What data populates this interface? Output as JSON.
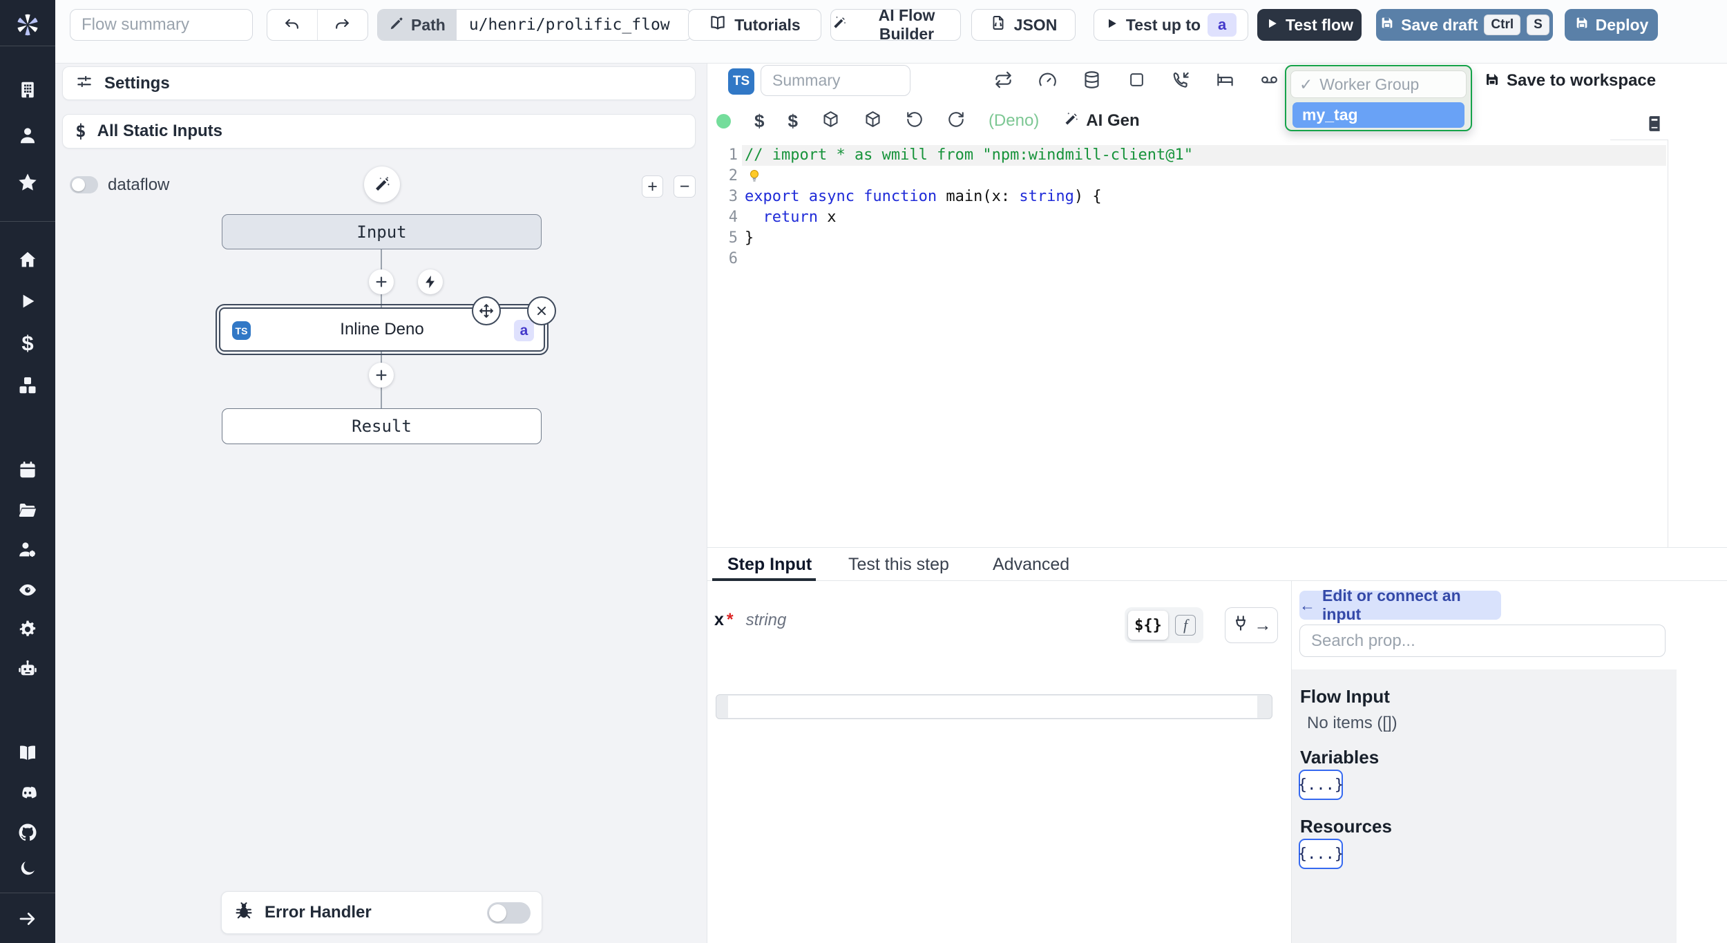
{
  "colors": {
    "sidebar_bg": "#1e2532",
    "primary_button": "#5a80a8",
    "dark_button": "#2b3442",
    "ts_badge": "#3178c6",
    "id_badge_bg": "#dfe1fd",
    "id_badge_text": "#4338ca",
    "worker_group_border": "#16a34a",
    "worker_group_selected_bg": "#69a2f6",
    "connect_pill_bg": "#d9e2fc",
    "connect_pill_text": "#3449a8",
    "code_comment": "#17933b",
    "code_keyword": "#1f2bd8"
  },
  "topbar": {
    "flow_summary_placeholder": "Flow summary",
    "path_label": "Path",
    "path_value": "u/henri/prolific_flow",
    "tutorials_label": "Tutorials",
    "ai_flow_builder_label": "AI Flow Builder",
    "json_label": "JSON",
    "test_up_to_label": "Test up to",
    "test_up_to_badge": "a",
    "test_flow_label": "Test flow",
    "save_draft_label": "Save draft",
    "shortcut_ctrl": "Ctrl",
    "shortcut_s": "S",
    "deploy_label": "Deploy"
  },
  "flow_panel": {
    "settings_label": "Settings",
    "all_static_inputs_label": "All Static Inputs",
    "static_inputs_icon": "$",
    "dataflow_label": "dataflow",
    "zoom_in": "+",
    "zoom_out": "−",
    "input_node": "Input",
    "step_node": {
      "lang_badge": "TS",
      "label": "Inline Deno",
      "id_badge": "a"
    },
    "result_node": "Result",
    "error_handler_label": "Error Handler"
  },
  "editor": {
    "lang_badge": "TS",
    "summary_placeholder": "Summary",
    "dollar_icon": "$",
    "worker_group_dropdown": {
      "check": "✓",
      "label": "Worker Group",
      "options": [
        "my_tag"
      ],
      "selected_option": "my_tag"
    },
    "save_to_workspace_label": "Save to workspace",
    "deno_label": "(Deno)",
    "ai_gen_label": "AI Gen",
    "line_numbers": [
      "1",
      "2",
      "3",
      "4",
      "5",
      "6"
    ],
    "code": {
      "line1_comment": "// import * as wmill from \"npm:windmill-client@1\"",
      "line3_keywords": "export async function ",
      "line3_name": "main",
      "line3_open": "(",
      "line3_param": "x",
      "line3_colon": ": ",
      "line3_type": "string",
      "line3_close": ") {",
      "line4_indent": "  ",
      "line4_keyword": "return",
      "line4_value": " x",
      "line5_brace": "}"
    }
  },
  "step_panel": {
    "tabs": [
      "Step Input",
      "Test this step",
      "Advanced"
    ],
    "arg": {
      "name": "x",
      "required_mark": "*",
      "type": "string"
    },
    "template_toggle": "${}",
    "fn_toggle": "f",
    "plug_arrow": "→",
    "connect_panel": {
      "back_arrow": "←",
      "edit_or_connect_label": "Edit or connect an input",
      "search_placeholder": "Search prop...",
      "flow_input_title": "Flow Input",
      "flow_input_empty": "No items ([])",
      "variables_title": "Variables",
      "variables_chip": "{...}",
      "resources_title": "Resources",
      "resources_chip": "{...}"
    }
  }
}
